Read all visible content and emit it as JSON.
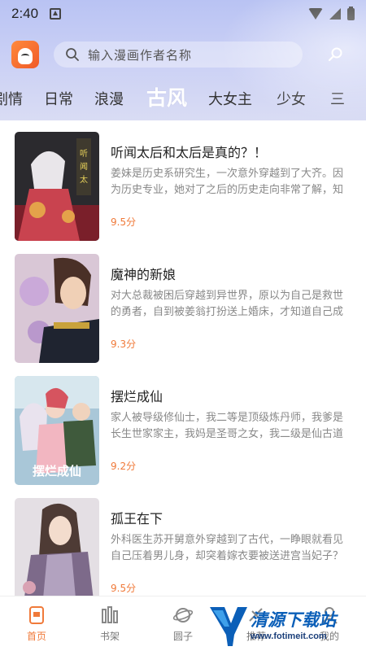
{
  "status_bar": {
    "time": "2:40"
  },
  "search": {
    "placeholder": "输入漫画作者名称"
  },
  "tabs": [
    {
      "label": "剧情"
    },
    {
      "label": "日常"
    },
    {
      "label": "浪漫"
    },
    {
      "label": "古风",
      "active": true
    },
    {
      "label": "大女主"
    },
    {
      "label": "少女"
    },
    {
      "label": "三"
    }
  ],
  "comics": [
    {
      "title": "听闻太后和太后是真的？！",
      "description": "姜妹是历史系研究生，一次意外穿越到了大齐。因为历史专业，她对了之后的历史走向非常了解，知道...",
      "score": "9.5分"
    },
    {
      "title": "魔神的新娘",
      "description": "对大总裁被困后穿越到异世界，原以为自己是救世的勇者，自到被姜翁打扮送上婚床，才知道自己成了...",
      "score": "9.3分"
    },
    {
      "title": "摆烂成仙",
      "description": "家人被导级修仙士，我二等是顶级炼丹师，我爹是长生世家家主，我妈是圣哥之女，我二级是仙古道统...",
      "score": "9.2分"
    },
    {
      "title": "孤王在下",
      "description": "外科医生苏开舅意外穿越到了古代，一睁眼就看见自己压着男儿身，却突着嫁衣要被送进宫当妃子？前...",
      "score": "9.5分"
    }
  ],
  "bottom_nav": [
    {
      "label": "首页",
      "icon": "home-icon",
      "active": true
    },
    {
      "label": "书架",
      "icon": "bookshelf-icon"
    },
    {
      "label": "圆子",
      "icon": "planet-icon"
    },
    {
      "label": "推荐",
      "icon": "recommend-icon"
    },
    {
      "label": "我的",
      "icon": "profile-icon"
    }
  ],
  "watermark": {
    "text": "清源下载站",
    "url": "www.fotimeit.com"
  },
  "colors": {
    "accent": "#f07a3a",
    "header_top": "#b9c3f3",
    "header_bottom": "#d9dcf4"
  }
}
